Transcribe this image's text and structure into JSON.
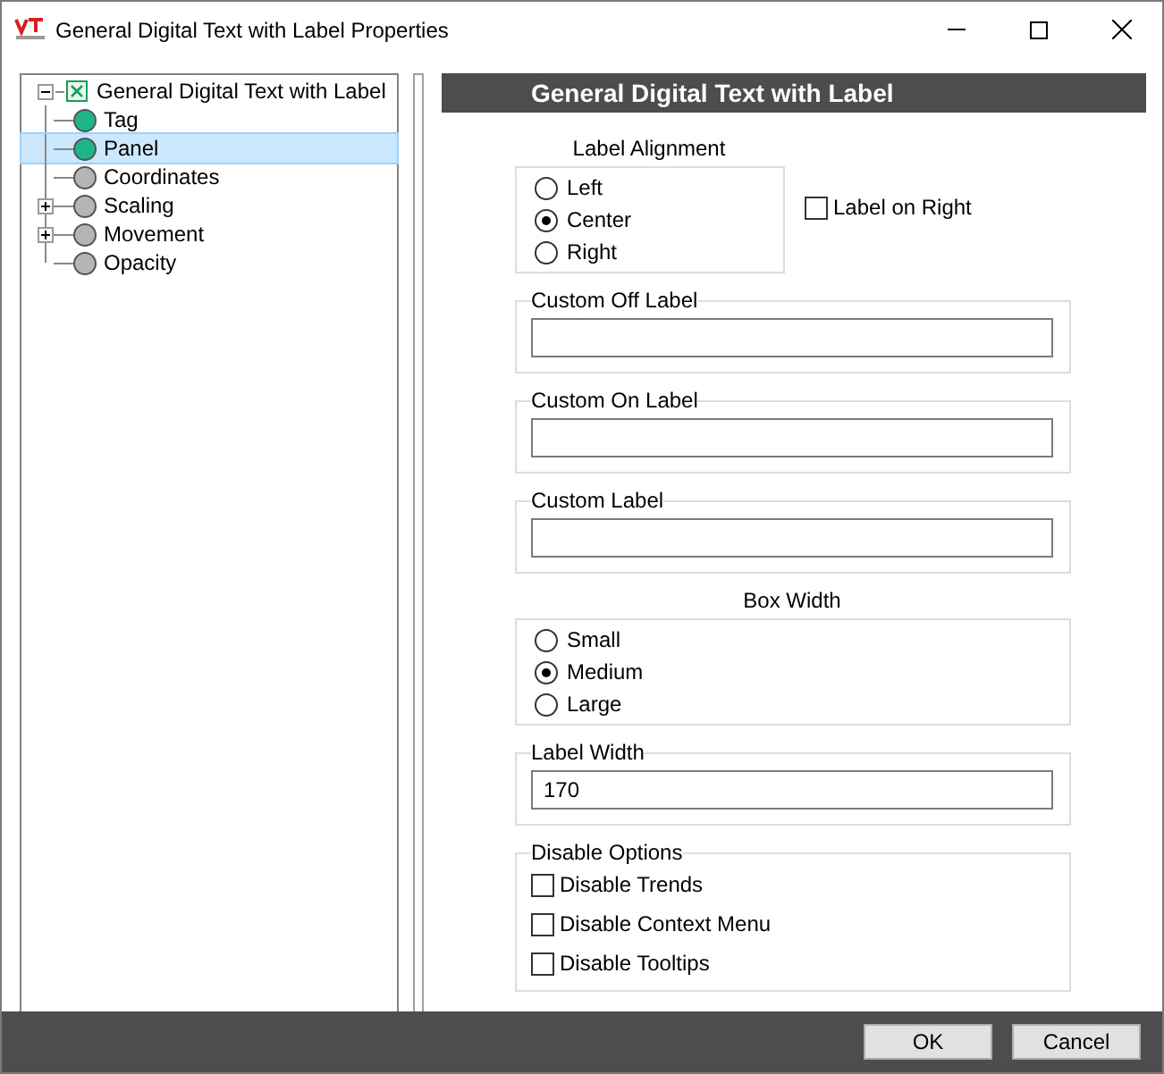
{
  "window": {
    "title": "General Digital Text with Label Properties"
  },
  "tree": {
    "label": "General Digital Text with Label",
    "expanded": true,
    "selected": false,
    "children": [
      {
        "label": "Tag",
        "color": "#1fb58a",
        "selected": false
      },
      {
        "label": "Panel",
        "color": "#1fb58a",
        "selected": true
      },
      {
        "label": "Coordinates",
        "color": "#b5b5b5",
        "selected": false
      },
      {
        "label": "Scaling",
        "color": "#b5b5b5",
        "selected": false,
        "expanded": false
      },
      {
        "label": "Movement",
        "color": "#b5b5b5",
        "selected": false,
        "expanded": false
      },
      {
        "label": "Opacity",
        "color": "#b5b5b5",
        "selected": false
      }
    ]
  },
  "panel": {
    "header": "General Digital Text with Label",
    "sections": [
      {
        "kind": "radio",
        "title": "Label Alignment",
        "options": [
          {
            "label": "Left",
            "selected": false
          },
          {
            "label": "Center",
            "selected": true
          },
          {
            "label": "Right",
            "selected": false
          }
        ],
        "side_checkbox": {
          "label": "Label on Right",
          "checked": false
        }
      },
      {
        "kind": "field",
        "title": "Custom Off Label"
      },
      {
        "kind": "field",
        "title": "Custom On Label"
      },
      {
        "kind": "field",
        "title": "Custom Label"
      },
      {
        "kind": "radio",
        "title": "Box Width",
        "options": [
          {
            "label": "Small",
            "selected": false
          },
          {
            "label": "Medium",
            "selected": true
          },
          {
            "label": "Large",
            "selected": false
          }
        ]
      },
      {
        "kind": "field",
        "title": "Label Width",
        "value": "170"
      },
      {
        "kind": "checks",
        "title": "Disable Options",
        "options": [
          {
            "label": "Disable Trends",
            "checked": false
          },
          {
            "label": "Disable Context Menu",
            "checked": false
          },
          {
            "label": "Disable Tooltips",
            "checked": false
          }
        ]
      }
    ]
  },
  "buttons": [
    "OK",
    "Cancel"
  ]
}
